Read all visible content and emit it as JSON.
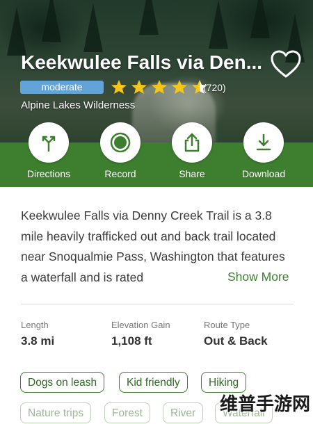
{
  "hero": {
    "title": "Keekwulee Falls via Den...",
    "difficulty": "moderate",
    "rating_stars": 4.5,
    "rating_count": "(720)",
    "area": "Alpine Lakes Wilderness"
  },
  "actions": [
    {
      "label": "Directions",
      "icon": "directions-icon"
    },
    {
      "label": "Record",
      "icon": "record-icon"
    },
    {
      "label": "Share",
      "icon": "share-icon"
    },
    {
      "label": "Download",
      "icon": "download-icon"
    }
  ],
  "description": {
    "text": "Keekwulee Falls via Denny Creek Trail is a 3.8 mile heavily trafficked out and back trail located near Snoqualmie Pass, Washington that features a waterfall and is rated",
    "show_more": "Show More"
  },
  "stats": [
    {
      "label": "Length",
      "value": "3.8 mi"
    },
    {
      "label": "Elevation Gain",
      "value": "1,108 ft"
    },
    {
      "label": "Route Type",
      "value": "Out & Back"
    }
  ],
  "tags": [
    "Dogs on leash",
    "Kid friendly",
    "Hiking",
    "Nature trips",
    "Forest",
    "River",
    "Waterfall"
  ],
  "watermark": "维普手游网",
  "colors": {
    "brand_green": "#3d7f2f",
    "difficulty_blue": "#62a3d8",
    "star_gold": "#f5c518"
  }
}
